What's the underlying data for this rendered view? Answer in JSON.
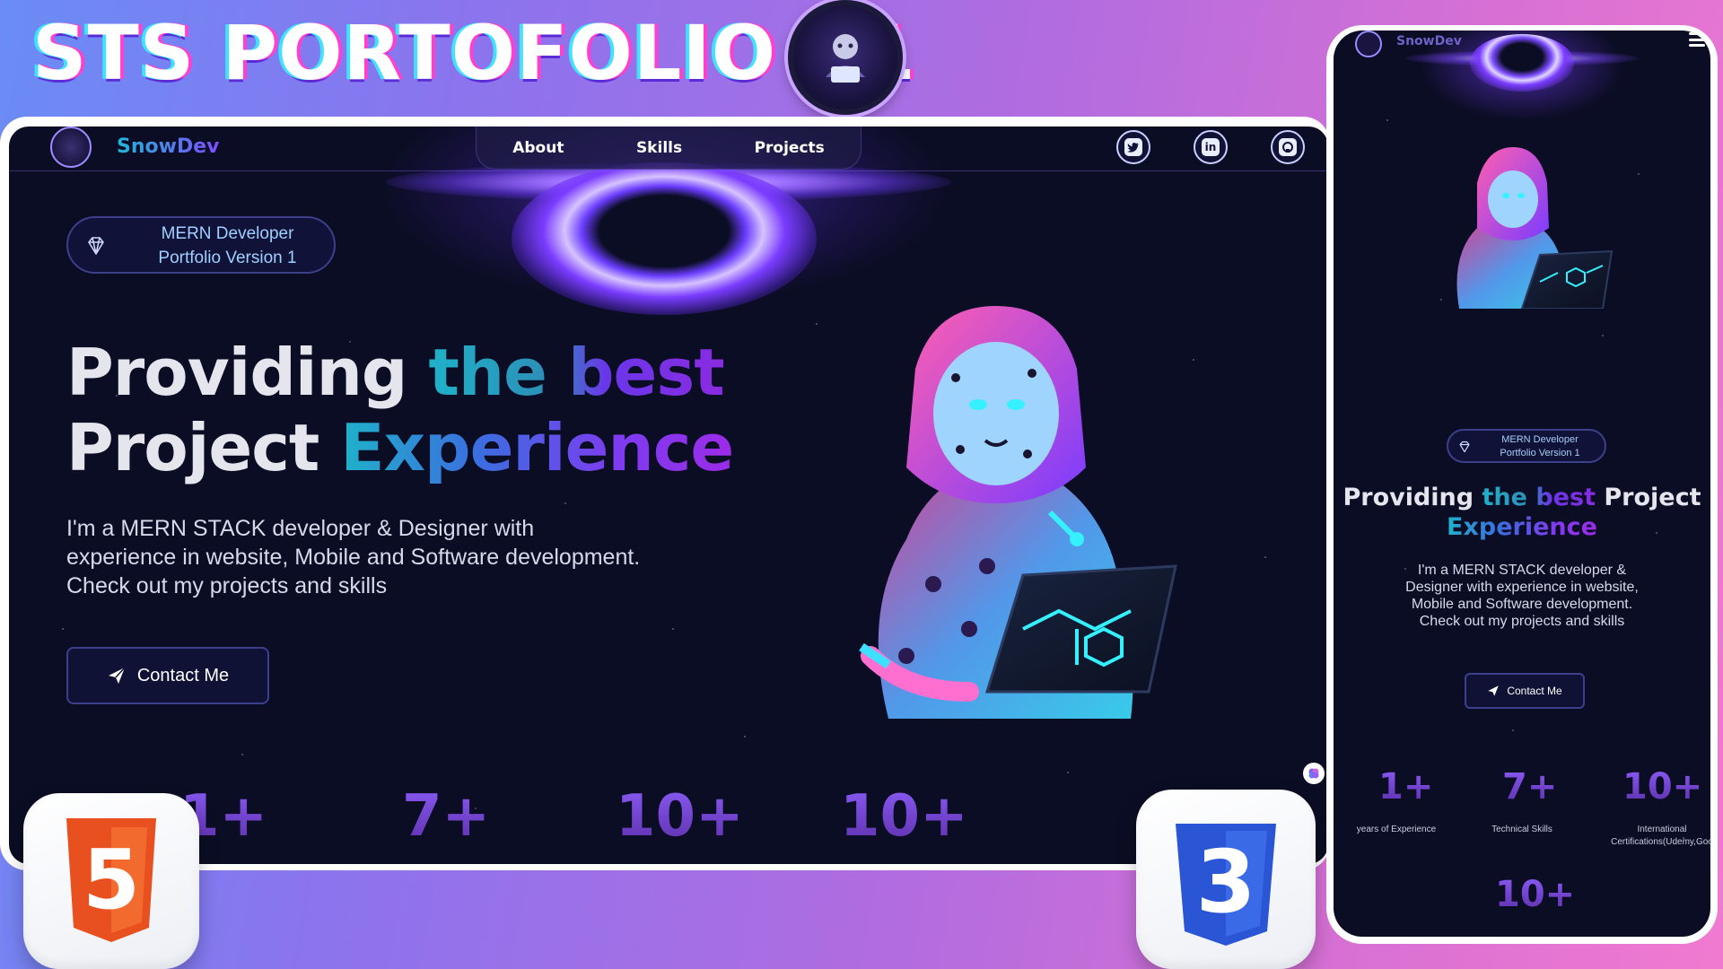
{
  "banner": {
    "title": "STS PORTOFOLIO V1"
  },
  "desktop": {
    "nav": {
      "brand": "SnowDev",
      "links": [
        "About",
        "Skills",
        "Projects"
      ],
      "socials": [
        "twitter-icon",
        "linkedin-icon",
        "github-icon"
      ]
    },
    "badge": {
      "line1": "MERN Developer",
      "line2": "Portfolio Version 1"
    },
    "hero": {
      "title_part1": "Providing ",
      "title_part2": "the best",
      "title_part3": "Project ",
      "title_part4": "Experience",
      "subtitle": "I'm a MERN STACK developer & Designer with experience in website, Mobile and Software development. Check out my projects and skills",
      "contact_label": "Contact Me"
    },
    "stats": [
      "1+",
      "7+",
      "10+",
      "10+"
    ]
  },
  "mobile": {
    "nav": {
      "brand": "SnowDev"
    },
    "badge": {
      "line1": "MERN Developer",
      "line2": "Portfolio Version 1"
    },
    "hero": {
      "title_part1": "Providing ",
      "title_part2": "the best",
      "title_part3": " Project",
      "title_part4": "Experience",
      "subtitle": "I'm a MERN STACK developer & Designer with experience in website, Mobile and Software development. Check out my projects and skills",
      "contact_label": "Contact Me"
    },
    "stats": [
      {
        "value": "1+",
        "label": "years of Experience"
      },
      {
        "value": "7+",
        "label": "Technical Skills"
      },
      {
        "value": "10+",
        "label": "International Certifications(Udemy,Goo"
      },
      {
        "value": "10+",
        "label": ""
      }
    ]
  },
  "tech_icons": {
    "html": "5",
    "css": "3"
  },
  "colors": {
    "accent_cyan": "#1fb2c9",
    "accent_purple": "#8a2be2",
    "background": "#0b0d24"
  }
}
